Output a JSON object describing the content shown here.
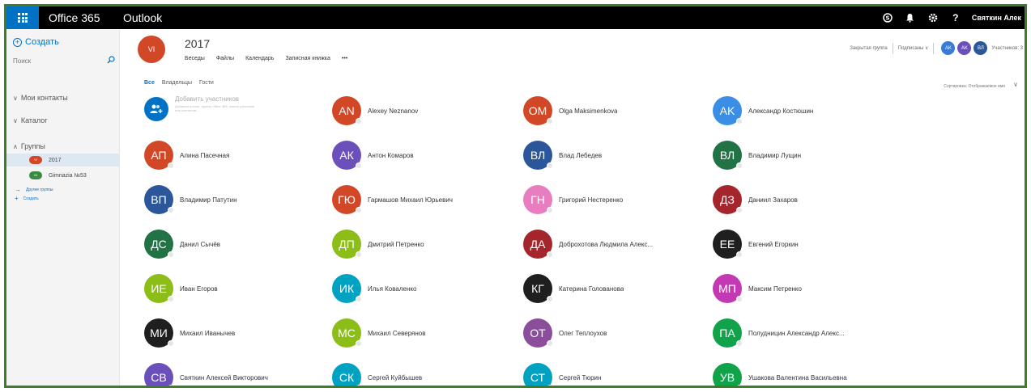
{
  "topbar": {
    "brand": "Office 365",
    "app": "Outlook",
    "user": "Святкин Алек",
    "waffle_icon": "waffle-icon",
    "icons": [
      "skype-icon",
      "bell-icon",
      "gear-icon",
      "help-icon"
    ],
    "help_glyph": "?"
  },
  "sidebar": {
    "create_label": "Создать",
    "search_placeholder": "Поиск",
    "my_contacts": "Мои контакты",
    "directory": "Каталог",
    "groups": "Группы",
    "group_items": [
      {
        "name": "2017",
        "initials": "VI",
        "color": "#d24726"
      },
      {
        "name": "Gimnazia №53",
        "initials": "GI",
        "color": "#3a8b3f"
      }
    ],
    "other_groups": "Другие группы",
    "create_small": "Создать"
  },
  "group": {
    "initials": "VI",
    "title": "2017",
    "tabs": [
      "Беседы",
      "Файлы",
      "Календарь",
      "Записная книжка",
      "•••"
    ],
    "privacy": "Закрытая группа",
    "subscribed": "Подписаны",
    "member_chips": [
      {
        "initials": "AK",
        "color": "#3a7bd5"
      },
      {
        "initials": "AK",
        "color": "#6b4fbb"
      },
      {
        "initials": "ВЛ",
        "color": "#2b579a"
      }
    ],
    "members_label": "Участников: 3"
  },
  "filters": [
    "Все",
    "Владельцы",
    "Гости"
  ],
  "sort_label": "Сортировка: Отображаемое имя",
  "add_member": {
    "title": "Добавить участников",
    "description": "Добавьте коллег, группы Office 365, списки рассылки или контактов ..."
  },
  "members": [
    {
      "initials": "AN",
      "name": "Alexey Neznanov",
      "color": "#d24726"
    },
    {
      "initials": "OM",
      "name": "Olga Maksimenkova",
      "color": "#d24726"
    },
    {
      "initials": "AK",
      "name": "Александр Костюшин",
      "color": "#3a8ee6"
    },
    {
      "initials": "АП",
      "name": "Алина Пасечная",
      "color": "#d24726"
    },
    {
      "initials": "АК",
      "name": "Антон Комаров",
      "color": "#6b4fbb"
    },
    {
      "initials": "ВЛ",
      "name": "Влад Лебедев",
      "color": "#2b579a"
    },
    {
      "initials": "ВЛ",
      "name": "Владимир Лущин",
      "color": "#217346"
    },
    {
      "initials": "ВП",
      "name": "Владимир Патутин",
      "color": "#2b579a"
    },
    {
      "initials": "ГЮ",
      "name": "Гармашов Михаил Юрьевич",
      "color": "#d24726"
    },
    {
      "initials": "ГН",
      "name": "Григорий Нестеренко",
      "color": "#e87dbf"
    },
    {
      "initials": "ДЗ",
      "name": "Даниил Захаров",
      "color": "#a4262c"
    },
    {
      "initials": "ДС",
      "name": "Данил Сычёв",
      "color": "#217346"
    },
    {
      "initials": "ДП",
      "name": "Дмитрий Петренко",
      "color": "#8cbd18"
    },
    {
      "initials": "ДА",
      "name": "Доброхотова Людмила Алекс...",
      "color": "#a4262c"
    },
    {
      "initials": "ЕЕ",
      "name": "Евгений Егоркин",
      "color": "#1f1f1f"
    },
    {
      "initials": "ИЕ",
      "name": "Иван Егоров",
      "color": "#8cbd18"
    },
    {
      "initials": "ИК",
      "name": "Илья Коваленко",
      "color": "#00a2c2"
    },
    {
      "initials": "КГ",
      "name": "Катерина Голованова",
      "color": "#1f1f1f"
    },
    {
      "initials": "МП",
      "name": "Максим Петренко",
      "color": "#c239b3"
    },
    {
      "initials": "МИ",
      "name": "Михаил Иванычев",
      "color": "#1f1f1f"
    },
    {
      "initials": "МС",
      "name": "Михаил Северянов",
      "color": "#8cbd18"
    },
    {
      "initials": "ОТ",
      "name": "Олег Теплоухов",
      "color": "#8a4e9a"
    },
    {
      "initials": "ПА",
      "name": "Полудницин Александр Алекс...",
      "color": "#10a34a"
    },
    {
      "initials": "СВ",
      "name": "Святкин Алексей Викторович",
      "color": "#6b4fbb"
    },
    {
      "initials": "СК",
      "name": "Сергей Куйбышев",
      "color": "#00a2c2"
    },
    {
      "initials": "СТ",
      "name": "Сергей Тюрин",
      "color": "#00a2c2"
    },
    {
      "initials": "УВ",
      "name": "Ушакова Валентина Васильевна",
      "color": "#10a34a"
    }
  ]
}
